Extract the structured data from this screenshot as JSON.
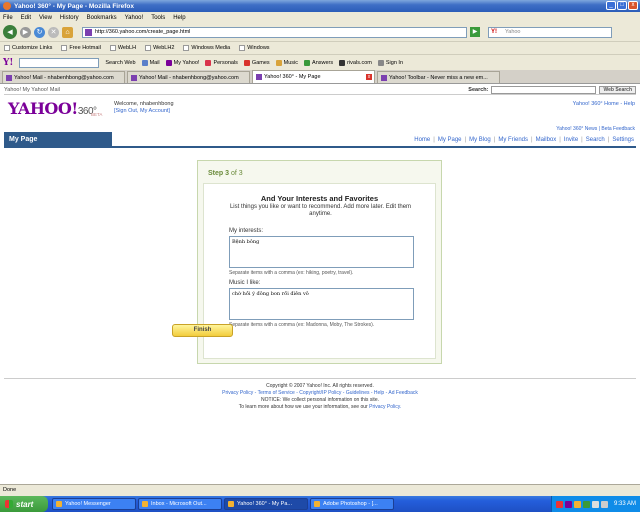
{
  "window": {
    "title": "Yahoo! 360° - My Page - Mozilla Firefox",
    "min": "_",
    "max": "□",
    "close": "x"
  },
  "menu": [
    "File",
    "Edit",
    "View",
    "History",
    "Bookmarks",
    "Yahoo!",
    "Tools",
    "Help"
  ],
  "nav": {
    "url": "http://360.yahoo.com/create_page.html",
    "search_placeholder": "Yahoo"
  },
  "bookmarks": [
    "Customize Links",
    "Free Hotmail",
    "WebLH",
    "WebLH2",
    "Windows Media",
    "Windows"
  ],
  "ytoolbar": {
    "items": [
      "Search Web",
      "Mail",
      "My Yahoo!",
      "Personals",
      "Games",
      "Music",
      "Answers",
      "rivals.com",
      "Sign In"
    ]
  },
  "tabs": [
    {
      "label": "Yahoo! Mail - nhabenhbong@yahoo.com",
      "active": false
    },
    {
      "label": "Yahoo! Mail - nhabenhbong@yahoo.com",
      "active": false
    },
    {
      "label": "Yahoo! 360° - My Page",
      "active": true
    },
    {
      "label": "Yahoo! Toolbar - Never miss a new em...",
      "active": false
    }
  ],
  "page": {
    "breadcrumb": "Yahoo!   My Yahoo!   Mail",
    "search_label": "Search:",
    "web_search_btn": "Web Search",
    "logo": "YAHOO!",
    "logo_360": "360°",
    "beta": "BETA",
    "welcome_line": "Welcome, nhabenhbong",
    "welcome_links": "[Sign Out, My Account]",
    "top_links": "Yahoo! 360° Home - Help",
    "news_links": "Yahoo! 360° News | Beta Feedback",
    "mypage_title": "My Page",
    "pagenav": [
      "Home",
      "My Page",
      "My Blog",
      "My Friends",
      "Mailbox",
      "Invite",
      "Search",
      "Settings"
    ]
  },
  "step": {
    "step_label": "Step 3",
    "step_of": "of 3",
    "heading": "And Your Interests and Favorites",
    "sub": "List things you like or want to recommend. Add more later. Edit them anytime.",
    "interests_label": "My interests:",
    "interests_value": "Bệnh bông",
    "interests_hint": "Separate items with a comma (ex: hiking, poetry, travel).",
    "music_label": "Music I like:",
    "music_value": "chờ hồi ý đông bon rồi điên vô",
    "music_hint": "Separate items with a comma (ex: Madonna, Moby, The Strokes).",
    "finish": "Finish"
  },
  "footer": {
    "copyright": "Copyright © 2007 Yahoo! Inc. All rights reserved.",
    "links": "Privacy Policy - Terms of Service - Copyright/IP Policy - Guidelines - Help - Ad Feedback",
    "notice": "NOTICE: We collect personal information on this site.",
    "learn": "To learn more about how we use your information, see our",
    "learn_link": "Privacy Policy."
  },
  "status": "Done",
  "taskbar": {
    "start": "start",
    "tasks": [
      "Yahoo! Messenger",
      "Inbox - Microsoft Out...",
      "Yahoo! 360° - My Pa...",
      "Adobe Photoshop - [..."
    ],
    "clock": "9:33 AM"
  },
  "colors": {
    "yahoo_purple": "#7b0099",
    "link_blue": "#3366cc",
    "mypage_bar": "#2f5a8a",
    "step_green": "#6a8a3a"
  }
}
